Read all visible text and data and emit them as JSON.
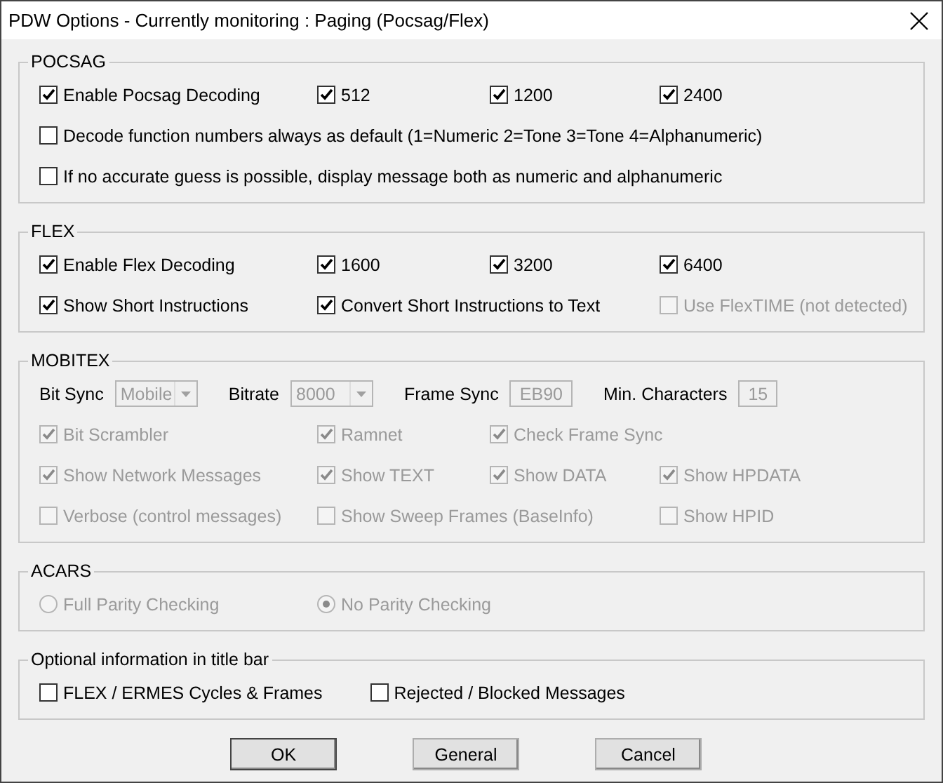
{
  "window": {
    "title": "PDW Options - Currently monitoring : Paging (Pocsag/Flex)"
  },
  "groups": [
    {
      "title": "POCSAG",
      "rows": [
        {
          "kind": "grid",
          "items": [
            {
              "kind": "checkbox",
              "label": "Enable Pocsag Decoding",
              "checked": true,
              "disabled": false
            },
            {
              "kind": "checkbox",
              "label": "512",
              "checked": true,
              "disabled": false
            },
            {
              "kind": "checkbox",
              "label": "1200",
              "checked": true,
              "disabled": false
            },
            {
              "kind": "checkbox",
              "label": "2400",
              "checked": true,
              "disabled": false
            }
          ]
        },
        {
          "kind": "grid",
          "items": [
            {
              "kind": "checkbox",
              "label": "Decode function numbers always as default (1=Numeric 2=Tone 3=Tone 4=Alphanumeric)",
              "checked": false,
              "disabled": false
            }
          ]
        },
        {
          "kind": "grid",
          "items": [
            {
              "kind": "checkbox",
              "label": "If no accurate guess is possible, display message both as numeric and alphanumeric",
              "checked": false,
              "disabled": false
            }
          ]
        }
      ]
    },
    {
      "title": "FLEX",
      "rows": [
        {
          "kind": "grid",
          "items": [
            {
              "kind": "checkbox",
              "label": "Enable Flex Decoding",
              "checked": true,
              "disabled": false
            },
            {
              "kind": "checkbox",
              "label": "1600",
              "checked": true,
              "disabled": false
            },
            {
              "kind": "checkbox",
              "label": "3200",
              "checked": true,
              "disabled": false
            },
            {
              "kind": "checkbox",
              "label": "6400",
              "checked": true,
              "disabled": false
            }
          ]
        },
        {
          "kind": "grid",
          "items": [
            {
              "kind": "checkbox",
              "label": "Show Short Instructions",
              "checked": true,
              "disabled": false
            },
            {
              "kind": "checkbox",
              "label": "Convert Short Instructions to Text",
              "checked": true,
              "disabled": false
            },
            {
              "kind": "empty"
            },
            {
              "kind": "checkbox",
              "label": "Use FlexTIME (not detected)",
              "checked": false,
              "disabled": true
            }
          ]
        }
      ]
    },
    {
      "title": "MOBITEX",
      "rows": [
        {
          "kind": "fields",
          "items": [
            {
              "kind": "dropdown",
              "label": "Bit Sync",
              "value": "Mobile",
              "disabled": true
            },
            {
              "kind": "dropdown",
              "label": "Bitrate",
              "value": "8000",
              "disabled": true
            },
            {
              "kind": "textbox",
              "label": "Frame Sync",
              "value": "EB90",
              "disabled": true
            },
            {
              "kind": "textbox",
              "label": "Min. Characters",
              "value": "15",
              "disabled": true
            }
          ]
        },
        {
          "kind": "grid",
          "items": [
            {
              "kind": "checkbox",
              "label": "Bit Scrambler",
              "checked": true,
              "disabled": true
            },
            {
              "kind": "checkbox",
              "label": "Ramnet",
              "checked": true,
              "disabled": true
            },
            {
              "kind": "checkbox",
              "label": "Check Frame Sync",
              "checked": true,
              "disabled": true
            }
          ]
        },
        {
          "kind": "grid",
          "items": [
            {
              "kind": "checkbox",
              "label": "Show Network Messages",
              "checked": true,
              "disabled": true
            },
            {
              "kind": "checkbox",
              "label": "Show TEXT",
              "checked": true,
              "disabled": true
            },
            {
              "kind": "checkbox",
              "label": "Show DATA",
              "checked": true,
              "disabled": true
            },
            {
              "kind": "checkbox",
              "label": "Show HPDATA",
              "checked": true,
              "disabled": true
            }
          ]
        },
        {
          "kind": "grid",
          "items": [
            {
              "kind": "checkbox",
              "label": "Verbose (control messages)",
              "checked": false,
              "disabled": true
            },
            {
              "kind": "checkbox",
              "label": "Show Sweep Frames (BaseInfo)",
              "checked": false,
              "disabled": true
            },
            {
              "kind": "empty"
            },
            {
              "kind": "checkbox",
              "label": "Show HPID",
              "checked": false,
              "disabled": true
            }
          ]
        }
      ]
    },
    {
      "title": "ACARS",
      "rows": [
        {
          "kind": "grid",
          "items": [
            {
              "kind": "radio",
              "label": "Full Parity Checking",
              "selected": false,
              "disabled": true
            },
            {
              "kind": "radio",
              "label": "No Parity Checking",
              "selected": true,
              "disabled": true
            }
          ]
        }
      ]
    },
    {
      "title": "Optional information in title bar",
      "rows": [
        {
          "kind": "pair",
          "items": [
            {
              "kind": "checkbox",
              "label": "FLEX / ERMES Cycles & Frames",
              "checked": false,
              "disabled": false
            },
            {
              "kind": "checkbox",
              "label": "Rejected / Blocked Messages",
              "checked": false,
              "disabled": false
            }
          ]
        }
      ]
    }
  ],
  "buttons": [
    {
      "label": "OK",
      "default": true
    },
    {
      "label": "General",
      "default": false
    },
    {
      "label": "Cancel",
      "default": false
    }
  ]
}
